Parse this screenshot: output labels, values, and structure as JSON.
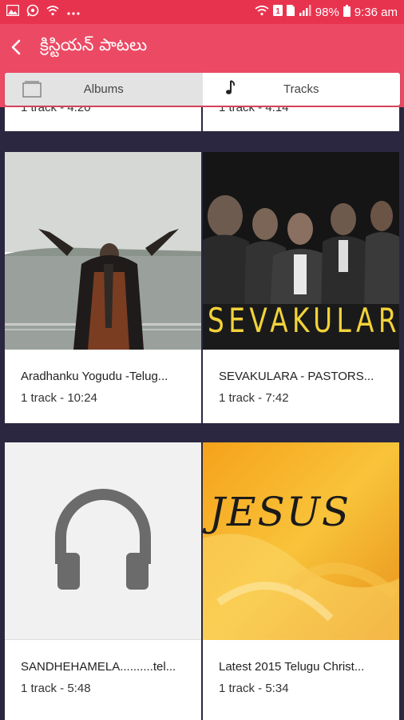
{
  "status": {
    "battery": "98%",
    "time": "9:36 am",
    "icons_left": [
      "image-icon",
      "whatsapp-icon",
      "wifi-icon",
      "more-icon"
    ],
    "icons_right": [
      "wifi-icon",
      "data-badge-icon",
      "sim-icon",
      "signal-icon",
      "battery-icon"
    ]
  },
  "app_bar": {
    "title": "క్రిస్టియన్ పాటలు"
  },
  "tabs": [
    {
      "label": "Albums",
      "icon": "album-icon",
      "active": true
    },
    {
      "label": "Tracks",
      "icon": "music-note-icon",
      "active": false
    }
  ],
  "albums": [
    {
      "title": "Aradhanku Yogudu -Telug...",
      "sub": "1 track - 10:24",
      "thumb": "person-lake-image"
    },
    {
      "title": "SEVAKULARA - PASTORS...",
      "sub": "1 track - 7:42",
      "thumb": "sevakulara-cover-image",
      "cover_text": "SEVAKULAR"
    },
    {
      "title": "SANDHEHAMELA..........tel...",
      "sub": "1 track - 5:48",
      "thumb": "headphones-icon"
    },
    {
      "title": "Latest 2015 Telugu Christ...",
      "sub": "1 track - 5:34",
      "thumb": "jesus-cover-image",
      "cover_text": "JESUS"
    }
  ],
  "colors": {
    "accent": "#ec4a64",
    "status_bar": "#e8334f",
    "background": "#2b2740"
  }
}
